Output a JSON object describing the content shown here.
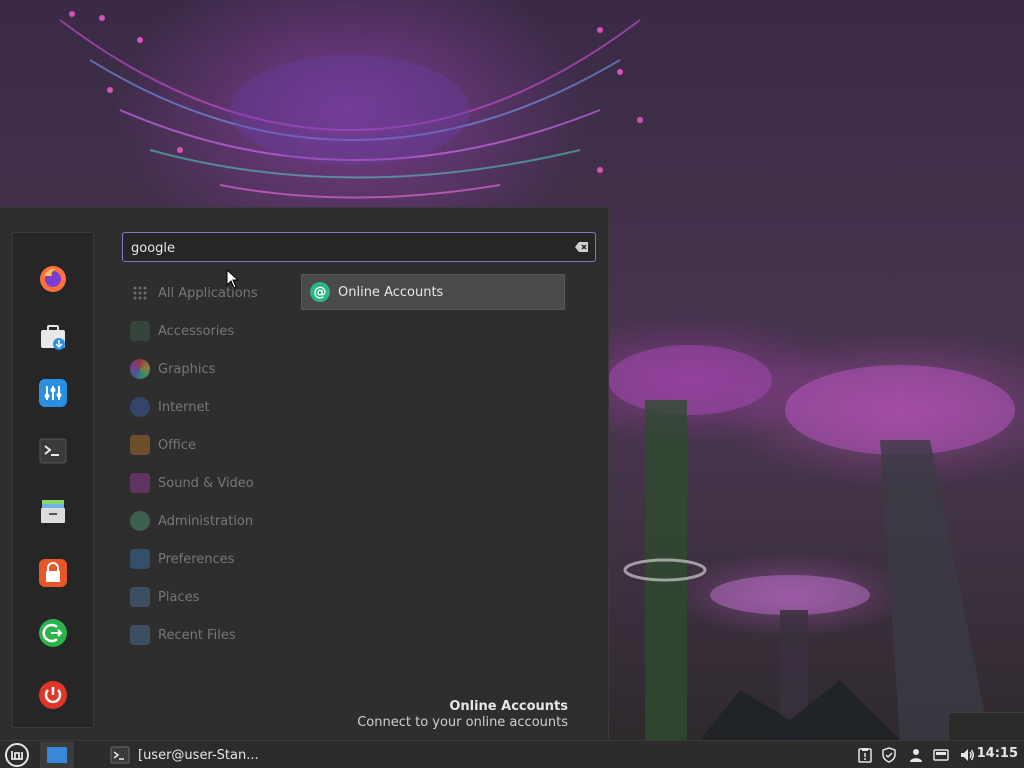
{
  "search": {
    "value": "google",
    "placeholder": ""
  },
  "categories": [
    {
      "label": "All Applications",
      "icon": "grid-icon"
    },
    {
      "label": "Accessories",
      "icon": "accessories-icon"
    },
    {
      "label": "Graphics",
      "icon": "graphics-icon"
    },
    {
      "label": "Internet",
      "icon": "internet-icon"
    },
    {
      "label": "Office",
      "icon": "office-icon"
    },
    {
      "label": "Sound & Video",
      "icon": "sound-video-icon"
    },
    {
      "label": "Administration",
      "icon": "administration-icon"
    },
    {
      "label": "Preferences",
      "icon": "preferences-icon"
    },
    {
      "label": "Places",
      "icon": "places-icon"
    },
    {
      "label": "Recent Files",
      "icon": "recent-files-icon"
    }
  ],
  "favorites": [
    {
      "name": "firefox",
      "icon": "firefox-icon",
      "color": "#ff7139"
    },
    {
      "name": "software-manager",
      "icon": "software-manager-icon",
      "color": "#e8e8e8"
    },
    {
      "name": "settings",
      "icon": "settings-icon",
      "color": "#2a8fe0"
    },
    {
      "name": "terminal",
      "icon": "terminal-icon",
      "color": "#3a3a3a"
    },
    {
      "name": "files",
      "icon": "files-icon",
      "color": "#dcdcdc"
    },
    {
      "name": "lock-screen",
      "icon": "lock-icon",
      "color": "#e8572a"
    },
    {
      "name": "logout",
      "icon": "logout-icon",
      "color": "#2bb34a"
    },
    {
      "name": "shutdown",
      "icon": "power-icon",
      "color": "#e0362a"
    }
  ],
  "result": {
    "label": "Online Accounts",
    "icon": "online-accounts-icon",
    "color": "#2bb58a"
  },
  "description": {
    "title": "Online Accounts",
    "text": "Connect to your online accounts"
  },
  "taskbar": {
    "window_label": "[user@user-Stan..."
  },
  "clock": {
    "time": "14:15"
  },
  "colors": {
    "accent": "#8a74c8",
    "panel": "#2c2c2c",
    "menu": "#2e2e2e"
  }
}
